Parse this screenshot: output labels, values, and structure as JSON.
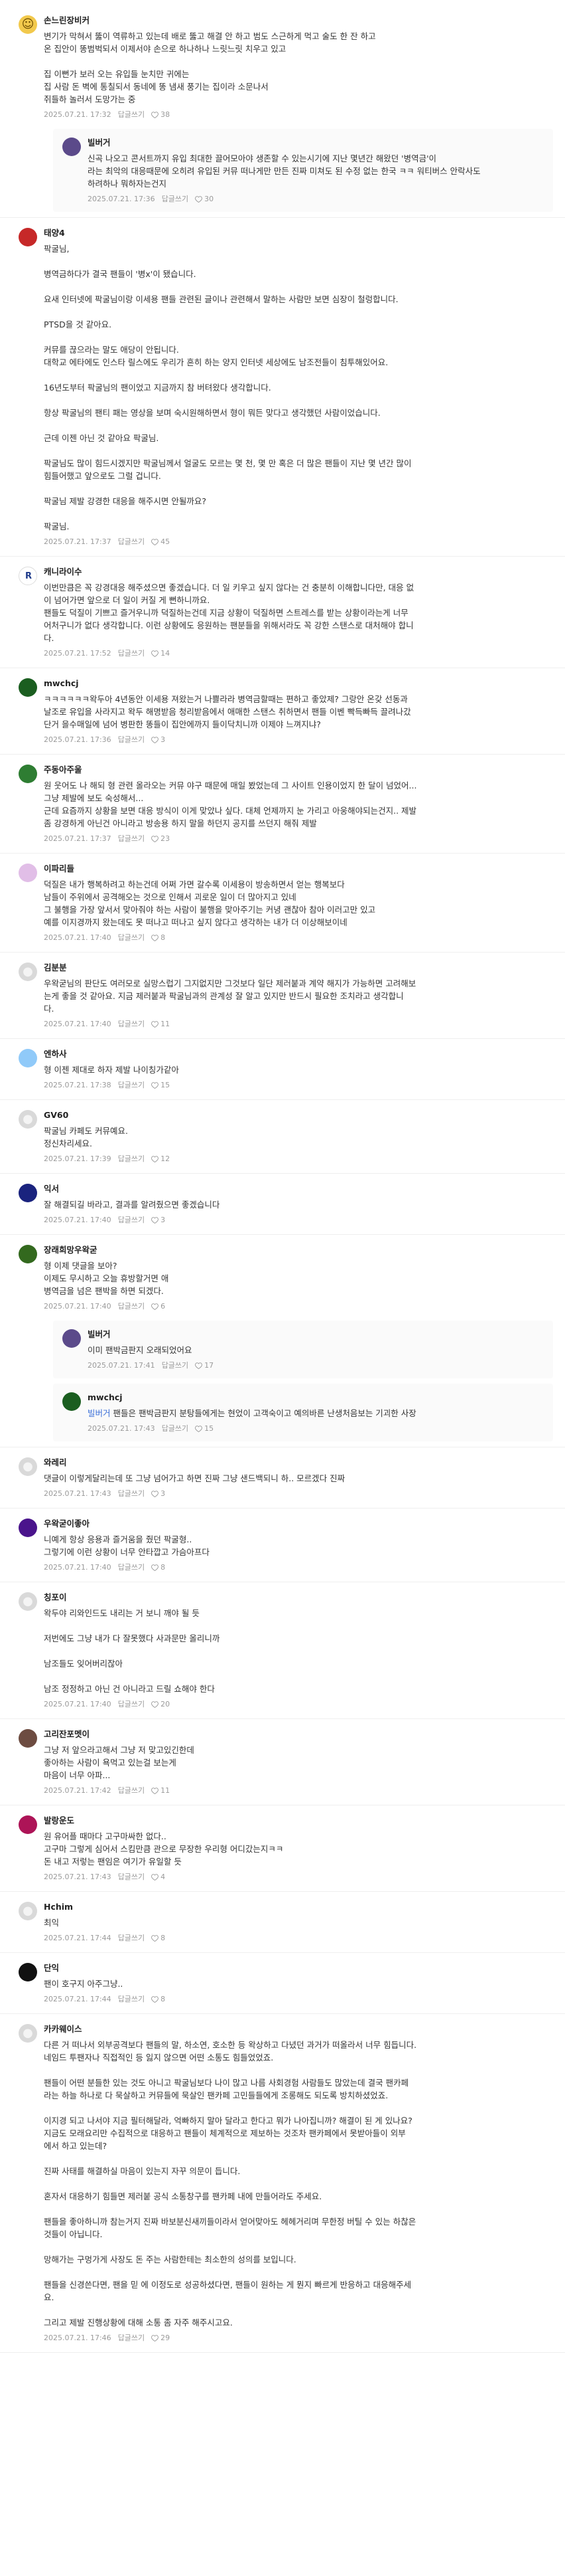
{
  "comments": [
    {
      "author": "손느린장비커",
      "avatar": {
        "color": "#f2c94c",
        "icon": "sticker-face"
      },
      "text": "변기가 막혀서 뚫이 역류하고 있는데 배로 뚫고 해결 안 하고 범도 스근하게 먹고 술도 한 잔 하고\n온 집안이 똥범벅되서 이제서야 손으로 하나하나 느릿느릿 치우고 있고\n\n집 이뻔가 보러 오는 유입들 눈치만 귀에는\n집 사람 돈 벽에 통칠되서 동네에 똥 냄새 풍기는 집이라 소문나서\n쥐들하 놀러서 도망가는 중",
      "date": "2025.07.21. 17:32",
      "reply_label": "답글쓰기",
      "likes": "38",
      "replies": [
        {
          "author": "빌버거",
          "avatar": {
            "color": "#5b4a8a",
            "icon": "photo"
          },
          "text": "신곡 나오고 콘서트까지 유입 최대한 끌어모아야 생존할 수 있는시기에 지난 몇년간 해왔던 '병역금'이\n라는 최악의 대응때문에 오히려 유입된 커뮤 떠나게만 만든 진짜 미쳐도 된 수정 없는 한국 ㅋㅋ 워티버스 안락사도\n하려하나 뭐하자는건지",
          "date": "2025.07.21. 17:36",
          "reply_label": "답글쓰기",
          "likes": "30"
        }
      ]
    },
    {
      "author": "태양4",
      "avatar": {
        "color": "#c62828",
        "icon": "photo"
      },
      "text": "팍굴님,\n\n병역금하다가 결국 팬들이 '병x'이 됐습니다.\n\n요새 인터넷에 팍굴님이랑 이세용 팬들 관련된 글이나 관련해서 말하는 사람만 보면 심장이 철렁합니다.\n\nPTSD을 것 같아요.\n\n커뮤를 끊으라는 말도 애당이 안됩니다.\n대학교 에타에도 인스타 릴스에도 우리가 흔히 하는 양지 인터넷 세상에도 남조전들이 침투해있어요.\n\n16년도부터 팍굴님의 팬이었고 지금까지 참 버텨왔다 생각합니다.\n\n항상 팍굴님의 팬티 패는 영상을 보며 숙시원해하면서 형이 뭐든 맞다고 생각했던 사람이었습니다.\n\n근데 이젠 아닌 것 같아요 팍굴님.\n\n팍굴님도 많이 힘드시겠지만 팍굴님께서 얼굴도 모르는 몇 천, 몇 만 혹은 더 많은 팬들이 지난 몇 년간 많이\n힘들어했고 앞으로도 그럴 겁니다.\n\n팍굴님 제발 강경한 대응을 해주시면 안될까요?\n\n팍굴님.",
      "date": "2025.07.21. 17:37",
      "reply_label": "답글쓰기",
      "likes": "45",
      "replies": []
    },
    {
      "author": "캐니라이수",
      "avatar": {
        "color": "#ffffff",
        "icon": "logo-r"
      },
      "text": "이번만큼은 꼭 강경대응 해주셨으면 좋겠습니다. 더 일 키우고 싶지 않다는 건 충분히 이해합니다만, 대응 없\n이 넘어가면 앞으로 더 일이 커질 게 뻔하니까요.\n팬들도 덕질이 기쁘고 즐거우니까 덕질하는건데 지금 상황이 덕질하면 스트레스를 받는 상황이라는게 너무\n어처구니가 없다 생각합니다. 이런 상황에도 응원하는 팬분들을 위해서라도 꼭 강한 스탠스로 대처해야 합니\n다.",
      "date": "2025.07.21. 17:52",
      "reply_label": "답글쓰기",
      "likes": "14",
      "replies": []
    },
    {
      "author": "mwchcj",
      "avatar": {
        "color": "#1b5e20",
        "icon": "photo"
      },
      "text": "ㅋㅋㅋㅋㅋㅋ왁두아 4년동안 이세용 져왔는거 나쁠라라 병역금할때는 편하고 좋았제? 그랑안 온갖 선동과\n날조로 유입을 사라지고 왁두 해명받음 청리받음에서 애매한 스탠스 취하면서 팬들 이벤 빡득빠득 끌려나갔\n단거 을수매일에 넘어 병판한 똥들이 집안에까지 들이닥치니까 이제야 느껴지냐?",
      "date": "2025.07.21. 17:36",
      "reply_label": "답글쓰기",
      "likes": "3",
      "replies": []
    },
    {
      "author": "주동아주울",
      "avatar": {
        "color": "#2e7d32",
        "icon": "photo"
      },
      "text": "원 웃어도 나 해되 형 관련 올라오는 커뮤 야구 때문에 매일 봤었는데 그 사이트 인용이었지 한 달이 넘었어...\n그냥 제발에 보도 숙성해서...\n근데 요즘까지 상황을 보면 대응 방식이 이게 맞았나 싶다. 대체 언제까지 눈 가리고 아웅해야되는건지.. 제발\n좀 강경하게 아닌건 아니라고 방송용 하지 말을 하던지 공지를 쓰던지 해줘 제발",
      "date": "2025.07.21. 17:37",
      "reply_label": "답글쓰기",
      "likes": "23",
      "replies": []
    },
    {
      "author": "이파리들",
      "avatar": {
        "color": "#e1bee7",
        "icon": "photo"
      },
      "text": "덕질은 내가 행복하려고 하는건데 어쩌 가면 갈수록 이세용이 방송하면서 얻는 행복보다\n남들이 주위에서 공격해오는 것으로 인해서 괴로운 일이 더 많아지고 있네\n그 불행을 가장 앞서서 맞아줘야 하는 사람이 불행을 맞아주기는 커녕 괜찮아 참아 이러고만 있고\n예를 이지경까지 왔는데도 못 떠나고 떠나고 싶지 않다고 생각하는 내가 더 이상해보이네",
      "date": "2025.07.21. 17:40",
      "reply_label": "답글쓰기",
      "likes": "8",
      "replies": []
    },
    {
      "author": "김분분",
      "avatar": {
        "color": "#d9d9d9",
        "icon": "default-person"
      },
      "text": "우왁굳님의 판단도 여러모로 실망스럽기 그지없지만 그것보다 일단 제러붙과 계약 해지가 가능하면 고려해보\n는게 좋을 것 같아요. 지금 제러붙과 팍굴님과의 관계성 잘 알고 있지만 반드시 필요한 조치라고 생각합니\n다.",
      "date": "2025.07.21. 17:40",
      "reply_label": "답글쓰기",
      "likes": "11",
      "replies": []
    },
    {
      "author": "엔하사",
      "avatar": {
        "color": "#90caf9",
        "icon": "photo"
      },
      "text": "형 이젠 제대로 하자 제발 나이칭가같아",
      "date": "2025.07.21. 17:38",
      "reply_label": "답글쓰기",
      "likes": "15",
      "replies": []
    },
    {
      "author": "GV60",
      "avatar": {
        "color": "#d9d9d9",
        "icon": "default-person"
      },
      "text": "팍굴님 카페도 커뮤예요.\n정신차리세요.",
      "date": "2025.07.21. 17:39",
      "reply_label": "답글쓰기",
      "likes": "12",
      "replies": []
    },
    {
      "author": "익서",
      "avatar": {
        "color": "#1a237e",
        "icon": "photo"
      },
      "text": "잘 해결되길 바라고, 결과를 알려줬으면 좋겠습니다",
      "date": "2025.07.21. 17:40",
      "reply_label": "답글쓰기",
      "likes": "3",
      "replies": []
    },
    {
      "author": "장래희망우왁굳",
      "avatar": {
        "color": "#33691e",
        "icon": "photo"
      },
      "text": "형 이제 댓글을 보아?\n이제도 무시하고 오늘 휴방할거면 애\n병역금을 넘은 팬박을 하면 되겠다.",
      "date": "2025.07.21. 17:40",
      "reply_label": "답글쓰기",
      "likes": "6",
      "replies": [
        {
          "author": "빌버거",
          "avatar": {
            "color": "#5b4a8a",
            "icon": "photo"
          },
          "text": "이미 팬박금판지 오래되었어요",
          "date": "2025.07.21. 17:41",
          "reply_label": "답글쓰기",
          "likes": "17"
        },
        {
          "author": "mwchcj",
          "avatar": {
            "color": "#1b5e20",
            "icon": "photo"
          },
          "mention": "빌버거",
          "text": "팬들은 팬박금판지 분탕들에게는 현었이 고객숙이고 예의바른 난생처음보는 기괴한 사장",
          "date": "2025.07.21. 17:43",
          "reply_label": "답글쓰기",
          "likes": "15"
        }
      ]
    },
    {
      "author": "와레리",
      "avatar": {
        "color": "#d9d9d9",
        "icon": "default-person"
      },
      "text": "댓글이 이렇게달리는데 또 그냥 넘어가고 하면 진짜 그냥 샌드백되니 하.. 모르겠다 진짜",
      "date": "2025.07.21. 17:43",
      "reply_label": "답글쓰기",
      "likes": "3",
      "replies": []
    },
    {
      "author": "우왁굳이좋아",
      "avatar": {
        "color": "#4a148c",
        "icon": "photo"
      },
      "text": "니예게 항상 응용과 즐거움을 줬던 팍굴형..\n그렇기에 이런 상황이 너무 안타깝고 가슴아프다",
      "date": "2025.07.21. 17:40",
      "reply_label": "답글쓰기",
      "likes": "8",
      "replies": []
    },
    {
      "author": "칭포이",
      "avatar": {
        "color": "#d9d9d9",
        "icon": "default-person"
      },
      "text": "왁두야 리와인드도 내리는 거 보니 깨야 될 듯\n\n저번에도 그냥 내가 다 잘못했다 사과문만 올리니까\n\n남조들도 잊어버리잖아\n\n남조 정정하고 아닌 건 아니라고 드릴 쇼해야 한다",
      "date": "2025.07.21. 17:40",
      "reply_label": "답글쓰기",
      "likes": "20",
      "replies": []
    },
    {
      "author": "고리잔포멧이",
      "avatar": {
        "color": "#6d4c41",
        "icon": "photo"
      },
      "text": "그냥 저 앞으라고해서 그냥 저 맞고있긴한데\n좋아하는 사람이 욕먹고 있는걸 보는게\n마음이 너무 아파...",
      "date": "2025.07.21. 17:42",
      "reply_label": "답글쓰기",
      "likes": "11",
      "replies": []
    },
    {
      "author": "발랑운도",
      "avatar": {
        "color": "#ad1457",
        "icon": "photo"
      },
      "text": "원 유어플 때마다 고구마싸한 없다..\n고구마 그렇게 심어서 스킴만큼 관으로 무장한 우리형 어디갔는지ㅋㅋ\n돈 내고 저렇는 팬임은 여기가 유일할 듯",
      "date": "2025.07.21. 17:43",
      "reply_label": "답글쓰기",
      "likes": "4",
      "replies": []
    },
    {
      "author": "Hchim",
      "avatar": {
        "color": "#d9d9d9",
        "icon": "default-person"
      },
      "text": "최익",
      "date": "2025.07.21. 17:44",
      "reply_label": "답글쓰기",
      "likes": "8",
      "replies": []
    },
    {
      "author": "단익",
      "avatar": {
        "color": "#111111",
        "icon": "photo"
      },
      "text": "팬이 호구지 아주그냥..",
      "date": "2025.07.21. 17:44",
      "reply_label": "답글쓰기",
      "likes": "8",
      "replies": []
    },
    {
      "author": "카카웨이스",
      "avatar": {
        "color": "#d9d9d9",
        "icon": "default-person"
      },
      "text": "다른 거 떠나서 외부공격보다 팬들의 말, 하소연, 호소한 등 왁상하고 다녔던 과거가 떠올라서 너무 힘듭니다.\n네임드 투팬자나 직접적인 등 잃지 않으면 어떤 소통도 힘들었었죠.\n\n팬들이 어떤 분들한 있는 것도 아니고 팍굴님보다 나이 많고 나름 사회경험 사람들도 많았는데 결국 팬카페\n라는 하늘 하나로 다 묵살하고 커뮤들에 묵살인 팬카페 고민들들에게 조롱해도 되도록 방치하셨었죠.\n\n이지경 되고 나서야 지금 필터해달라, 억빠하지 말아 달라고 한다고 뭐가 나아집니까? 해결이 된 게 있나요?\n지금도 모래요리만 수집적으로 대응하고 팬들이 체계적으로 제보하는 것조차 팬카페에서 못받아들이 외부\n에서 하고 있는데?\n\n진짜 사태를 해결하실 마음이 있는지 자꾸 의문이 듭니다.\n\n혼자서 대응하기 힘들면 제러붙 공식 소통창구를 팬카페 내에 만들어라도 주세요.\n\n팬들을 좋아하니까 참는거지 진짜 바보분신새끼들이라서 얻어맞아도 헤헤거리며 무한정 버틸 수 있는 하찮은\n것들이 아닙니다.\n\n망해가는 구멍가게 사장도 돈 주는 사람한테는 최소한의 성의를 보입니다.\n\n팬들을 신경쓴다면, 팬을 믿 에 이정도로 성공하셨다면, 팬들이 원하는 게 뭔지 빠르게 반응하고 대응해주세\n요.\n\n그리고 제발 진행상황에 대해 소통 좀 자주 해주시고요.",
      "date": "2025.07.21. 17:46",
      "reply_label": "답글쓰기",
      "likes": "29",
      "replies": []
    }
  ]
}
